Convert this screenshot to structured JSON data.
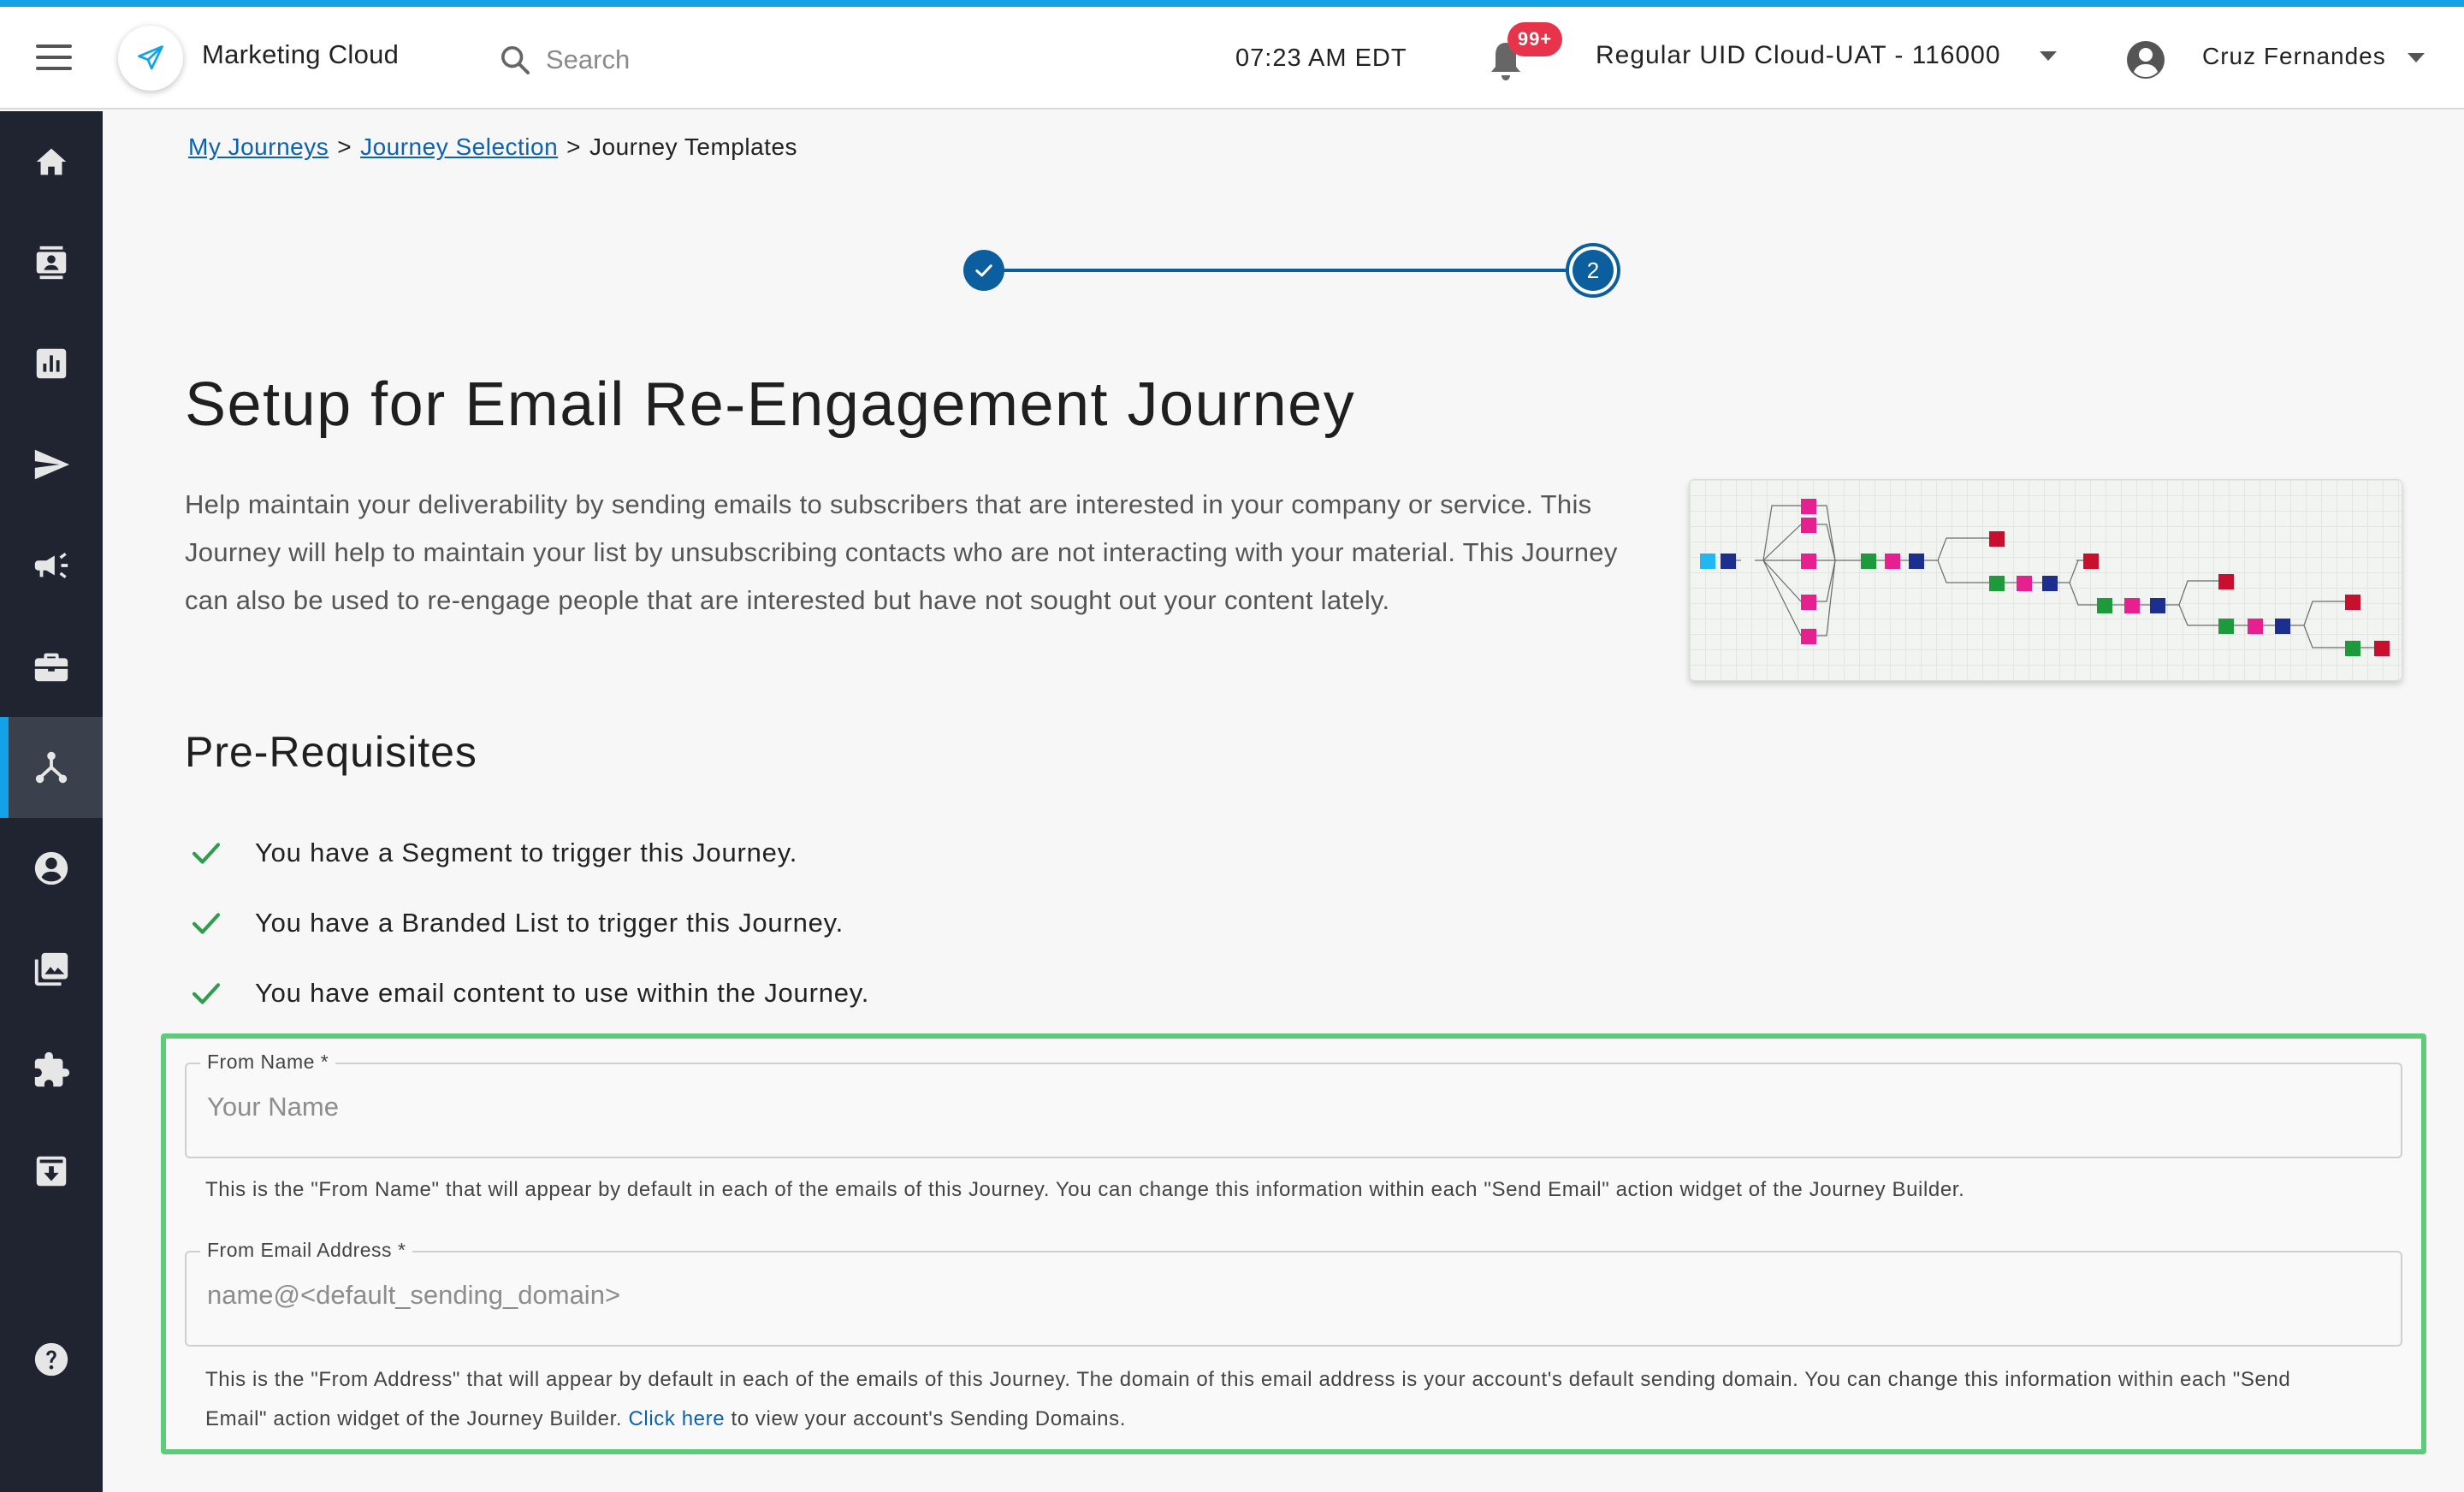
{
  "app": {
    "title": "Marketing Cloud"
  },
  "search": {
    "placeholder": "Search"
  },
  "header": {
    "time": "07:23 AM EDT",
    "notifications_badge": "99+",
    "account_name": "Regular UID Cloud-UAT - 116000",
    "user_name": "Cruz Fernandes"
  },
  "sidebar": {
    "items": [
      {
        "icon": "home-icon"
      },
      {
        "icon": "contacts-icon"
      },
      {
        "icon": "analytics-icon"
      },
      {
        "icon": "send-icon"
      },
      {
        "icon": "campaign-icon"
      },
      {
        "icon": "briefcase-icon"
      },
      {
        "icon": "journey-icon",
        "active": true
      },
      {
        "icon": "account-icon"
      },
      {
        "icon": "media-icon"
      },
      {
        "icon": "extension-icon"
      },
      {
        "icon": "archive-icon"
      },
      {
        "icon": "help-icon"
      }
    ]
  },
  "breadcrumb": {
    "items": [
      "My Journeys",
      "Journey Selection",
      "Journey Templates"
    ],
    "separator": ">"
  },
  "stepper": {
    "current_step": "2"
  },
  "page": {
    "title": "Setup for Email Re-Engagement Journey",
    "description": "Help maintain your deliverability by sending emails to subscribers that are interested in your company or service. This Journey will help to maintain your list by unsubscribing contacts who are not interacting with your material. This Journey can also be used to re-engage people that are interested but have not sought out your content lately."
  },
  "prerequisites": {
    "heading": "Pre-Requisites",
    "items": [
      "You have a Segment to trigger this Journey.",
      "You have a Branded List to trigger this Journey.",
      "You have email content to use within the Journey."
    ]
  },
  "form": {
    "from_name": {
      "label": "From Name *",
      "placeholder": "Your Name",
      "help": "This is the \"From Name\" that will appear by default in each of the emails of this Journey. You can change this information within each \"Send Email\" action widget of the Journey Builder."
    },
    "from_email": {
      "label": "From Email Address *",
      "placeholder": "name@<default_sending_domain>",
      "help_line1": "This is the \"From Address\" that will appear by default in each of the emails of this Journey. The domain of this email address is your account's default sending domain. You can change this information within each \"Send",
      "help_line2_prefix": "Email\" action widget of the Journey Builder.",
      "help_link": "Click here",
      "help_line2_suffix": "to view your account's Sending Domains."
    }
  },
  "colors": {
    "accent": "#12a2e8",
    "primary": "#0b5f9e",
    "sidebar_bg": "#1f2430",
    "highlight_border": "#5ecb7a",
    "check_green": "#2e9d4c",
    "badge_red": "#e8344a"
  }
}
